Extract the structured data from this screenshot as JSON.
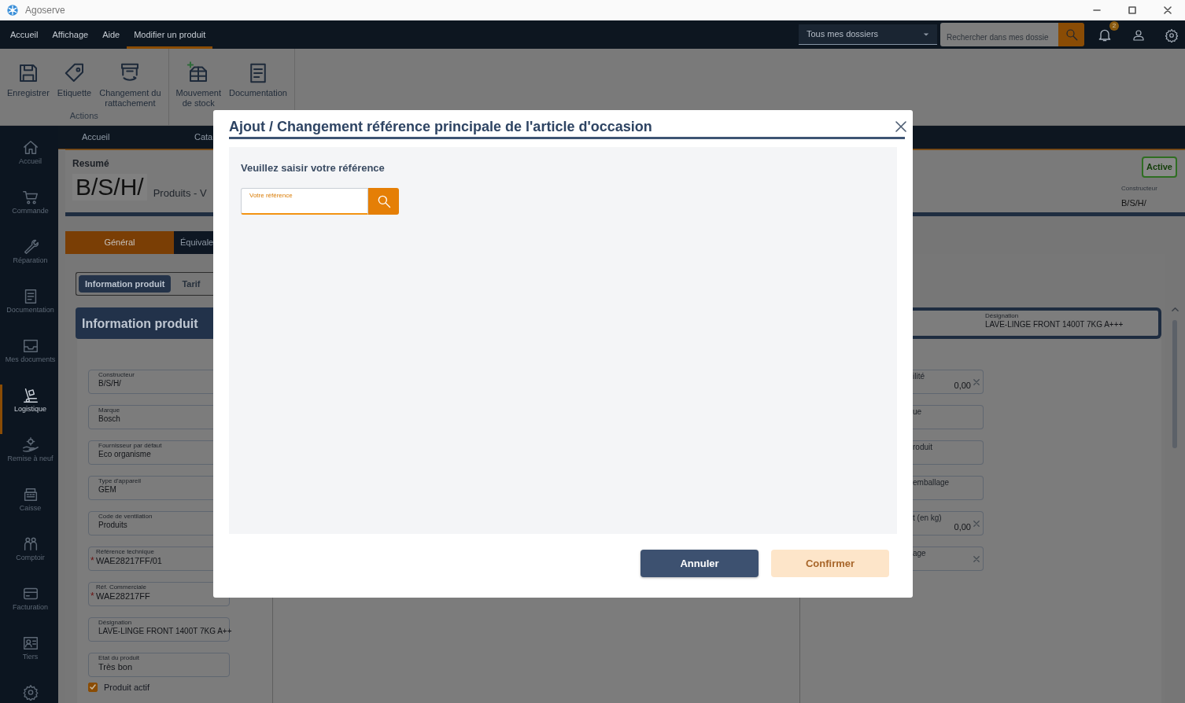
{
  "window": {
    "title": "Agoserve"
  },
  "menu": [
    {
      "label": "Accueil",
      "selected": false
    },
    {
      "label": "Affichage",
      "selected": false
    },
    {
      "label": "Aide",
      "selected": false
    },
    {
      "label": "Modifier un produit",
      "selected": true
    }
  ],
  "folder_select": {
    "value": "Tous mes dossiers"
  },
  "search": {
    "placeholder": "Rechercher dans mes dossie"
  },
  "notifications": {
    "count": "2"
  },
  "ribbon": [
    {
      "label": "Actions",
      "buttons": [
        {
          "label": "Enregistrer"
        },
        {
          "label": "Etiquette"
        },
        {
          "label": "Changement du\nrattachement"
        }
      ]
    },
    {
      "buttons": [
        {
          "label": "Mouvement\nde stock"
        },
        {
          "label": "Documentation"
        }
      ]
    }
  ],
  "sidebar": {
    "items": [
      {
        "label": "Accueil",
        "selected": false
      },
      {
        "label": "Commande",
        "selected": false
      },
      {
        "label": "Réparation",
        "selected": false
      },
      {
        "label": "Documentation",
        "selected": false
      },
      {
        "label": "Mes documents",
        "selected": false
      },
      {
        "label": "Logistique",
        "selected": true
      },
      {
        "label": "Remise à neuf",
        "selected": false
      },
      {
        "label": "Caisse",
        "selected": false
      },
      {
        "label": "Comptoir",
        "selected": false
      },
      {
        "label": "Facturation",
        "selected": false
      },
      {
        "label": "Tiers",
        "selected": false
      },
      {
        "selected": false
      }
    ]
  },
  "breadcrumb": [
    "Accueil",
    "Cata"
  ],
  "summary": {
    "title": "Resumé",
    "code": "B/S/H/",
    "subtitle": "Produits - V",
    "status": "Active",
    "maker_label": "Constructeur",
    "maker": "B/S/H/"
  },
  "tabs": [
    {
      "label": "Général",
      "selected": true
    },
    {
      "label": "Équivale",
      "selected": false
    }
  ],
  "subtabs": [
    {
      "label": "Information produit",
      "selected": true
    },
    {
      "label": "Tarif",
      "selected": false
    }
  ],
  "section_title": "Information produit",
  "designation_header": {
    "label": "Désignation",
    "value": "LAVE-LINGE FRONT 1400T 7KG A+++"
  },
  "left_fields": [
    {
      "label": "Constructeur",
      "value": "B/S/H/",
      "kind": "text"
    },
    {
      "label": "Marque",
      "value": "Bosch",
      "kind": "text"
    },
    {
      "label": "Fournisseur par défaut",
      "value": "Eco organisme",
      "kind": "text"
    },
    {
      "label": "Type d'appareil",
      "value": "GEM",
      "kind": "text"
    },
    {
      "label": "Code de ventilation",
      "value": "Produits",
      "kind": "text"
    },
    {
      "label": "Référence technique",
      "value": "WAE28217FF/01",
      "kind": "copy",
      "required_mark": "*"
    },
    {
      "label": "Réf. Commerciale",
      "value": "WAE28217FF",
      "kind": "copy",
      "required_mark": "*"
    },
    {
      "label": "Désignation",
      "value": "LAVE-LINGE FRONT 1400T 7KG A++",
      "kind": "text"
    },
    {
      "label": "Etat du produit",
      "value": "Très bon",
      "kind": "select"
    }
  ],
  "checkboxes": [
    {
      "label": "Produit actif",
      "checked": true
    }
  ],
  "right_fields": [
    {
      "label": "ilité",
      "value": "0,00",
      "clearable": true
    },
    {
      "label": "ue",
      "clearable": false
    },
    {
      "label": "roduit",
      "clearable": false
    },
    {
      "label": "emballage",
      "clearable": false
    },
    {
      "label": "t (en kg)",
      "value": "0,00",
      "clearable": true
    },
    {
      "label": "age",
      "clearable": true
    }
  ],
  "dialog": {
    "title": "Ajout / Changement référence principale de l'article d'occasion",
    "prompt": "Veuillez saisir votre référence",
    "field": {
      "label": "Votre référence"
    },
    "buttons": [
      {
        "label": "Annuler",
        "kind": "secondary",
        "disabled": false
      },
      {
        "label": "Confirmer",
        "kind": "primary",
        "disabled": true
      }
    ]
  }
}
